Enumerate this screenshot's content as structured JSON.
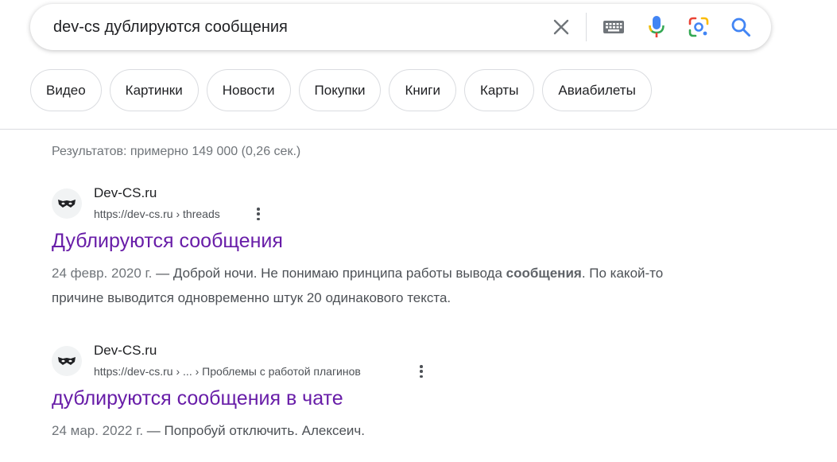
{
  "search": {
    "query": "dev-cs дублируются сообщения",
    "icons": [
      "close-icon",
      "keyboard-icon",
      "microphone-icon",
      "lens-icon",
      "search-icon"
    ]
  },
  "chips": [
    "Видео",
    "Картинки",
    "Новости",
    "Покупки",
    "Книги",
    "Карты",
    "Авиабилеты"
  ],
  "stats": "Результатов: примерно 149 000 (0,26 сек.)",
  "results": [
    {
      "site": "Dev-CS.ru",
      "url": "https://dev-cs.ru › threads",
      "title": "Дублируются сообщения",
      "date": "24 февр. 2020 г.",
      "dash": " — ",
      "snippet_a": "Доброй ночи. Не понимаю принципа работы вывода ",
      "snippet_bold": "сообщения",
      "snippet_b": ". По какой-то причине выводится одновременно штук 20 одинакового текста."
    },
    {
      "site": "Dev-CS.ru",
      "url": "https://dev-cs.ru › ... › Проблемы с работой плагинов",
      "title": "дублируются сообщения в чате",
      "date": "24 мар. 2022 г.",
      "dash": " — ",
      "snippet_a": "Попробуй отключить. Алексеич.",
      "snippet_bold": "",
      "snippet_b": ""
    }
  ],
  "colors": {
    "link_visited": "#681da8",
    "mic_blue": "#4285f4",
    "mic_red": "#ea4335",
    "search_blue": "#4285f4"
  }
}
